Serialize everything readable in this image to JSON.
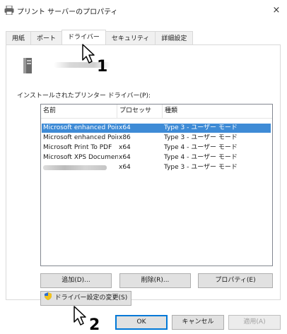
{
  "window": {
    "title": "プリント サーバーのプロパティ",
    "close": "×"
  },
  "tabs": [
    {
      "label": "用紙",
      "active": false
    },
    {
      "label": "ポート",
      "active": false
    },
    {
      "label": "ドライバー",
      "active": true
    },
    {
      "label": "セキュリティ",
      "active": false
    },
    {
      "label": "詳細設定",
      "active": false
    }
  ],
  "drivers": {
    "label": "インストールされたプリンター ドライバー(P):",
    "columns": {
      "name": "名前",
      "processor": "プロセッサ",
      "type": "種類"
    },
    "rows": [
      {
        "name": "Microsoft enhanced Point...",
        "processor": "x64",
        "type": "Type 3 - ユーザー モード",
        "selected": true
      },
      {
        "name": "Microsoft enhanced Point...",
        "processor": "x86",
        "type": "Type 3 - ユーザー モード",
        "selected": false
      },
      {
        "name": "Microsoft Print To PDF",
        "processor": "x64",
        "type": "Type 4 - ユーザー モード",
        "selected": false
      },
      {
        "name": "Microsoft XPS Document ...",
        "processor": "x64",
        "type": "Type 4 - ユーザー モード",
        "selected": false
      },
      {
        "name": "",
        "processor": "x64",
        "type": "Type 3 - ユーザー モード",
        "selected": false
      }
    ]
  },
  "buttons": {
    "add": "追加(D)...",
    "remove": "削除(R)...",
    "properties": "プロパティ(E)",
    "change_settings": "ドライバー設定の変更(S)",
    "ok": "OK",
    "cancel": "キャンセル",
    "apply": "適用(A)"
  },
  "callouts": {
    "step1": "1",
    "step2": "2"
  },
  "colors": {
    "selection": "#3e8bd6",
    "focus": "#0078d7"
  }
}
